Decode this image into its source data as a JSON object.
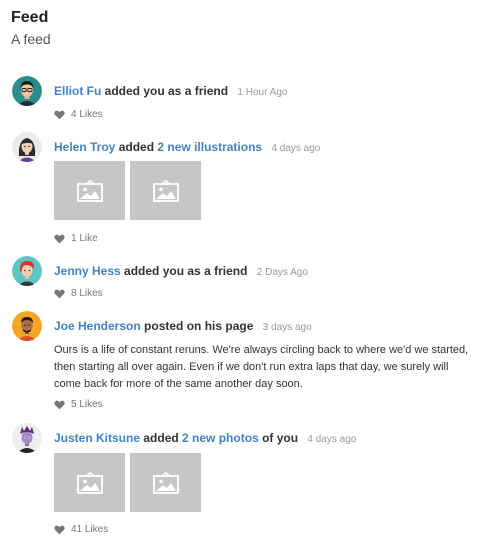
{
  "feed": {
    "title": "Feed",
    "subtitle": "A feed"
  },
  "events": [
    {
      "user": "Elliot Fu",
      "action": "added you as a friend",
      "date": "1 Hour Ago",
      "likes": "4 Likes"
    },
    {
      "user": "Helen Troy",
      "action": "added",
      "link": "2 new illustrations",
      "date": "4 days ago",
      "likes": "1 Like"
    },
    {
      "user": "Jenny Hess",
      "action": "added you as a friend",
      "date": "2 Days Ago",
      "likes": "8 Likes"
    },
    {
      "user": "Joe Henderson",
      "action": "posted on his page",
      "date": "3 days ago",
      "text": "Ours is a life of constant reruns. We're always circling back to where we'd we started, then starting all over again. Even if we don't run extra laps that day, we surely will come back for more of the same another day soon.",
      "likes": "5 Likes"
    },
    {
      "user": "Justen Kitsune",
      "action": "added",
      "link": "2 new photos",
      "action_suffix": "of you",
      "date": "4 days ago",
      "likes": "41 Likes"
    }
  ],
  "colors": {
    "link": "#4183c4",
    "placeholder": "#c6c6c6"
  },
  "icons": {
    "like": "heart-icon",
    "image_placeholder": "image-placeholder-icon"
  }
}
